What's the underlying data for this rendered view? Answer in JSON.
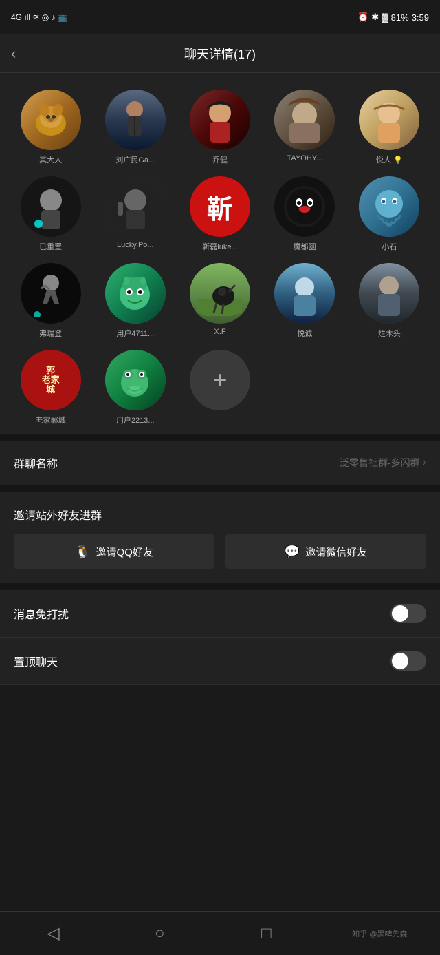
{
  "statusBar": {
    "signal": "4G",
    "time": "3:59",
    "battery": "81%"
  },
  "header": {
    "back": "‹",
    "title": "聊天详情(17)"
  },
  "members": [
    {
      "id": 1,
      "name": "真大人",
      "avatarClass": "av-shiba"
    },
    {
      "id": 2,
      "name": "刘广民Ga...",
      "avatarClass": "av-figure"
    },
    {
      "id": 3,
      "name": "乔健",
      "avatarClass": "av-girl"
    },
    {
      "id": 4,
      "name": "TAYOHY...",
      "avatarClass": "av-ancient"
    },
    {
      "id": 5,
      "name": "悦人 💡",
      "avatarClass": "av-lady"
    },
    {
      "id": 6,
      "name": "已重置",
      "avatarClass": "av-tiktok-man"
    },
    {
      "id": 7,
      "name": "Lucky.Po...",
      "avatarClass": "av-lucky"
    },
    {
      "id": 8,
      "name": "靳磊luke...",
      "avatarClass": "av-zhan",
      "text": "靳"
    },
    {
      "id": 9,
      "name": "魔都圆",
      "avatarClass": "av-kumamon"
    },
    {
      "id": 10,
      "name": "小石",
      "avatarClass": "av-octopus"
    },
    {
      "id": 11,
      "name": "弗瑞登",
      "avatarClass": "av-runner"
    },
    {
      "id": 12,
      "name": "用户4711...",
      "avatarClass": "av-monster-green"
    },
    {
      "id": 13,
      "name": "X.F",
      "avatarClass": "av-horse-field"
    },
    {
      "id": 14,
      "name": "悦诚",
      "avatarClass": "av-person-blue"
    },
    {
      "id": 15,
      "name": "烂木头",
      "avatarClass": "av-outdoor"
    },
    {
      "id": 16,
      "name": "老家郸城",
      "avatarClass": "av-郭",
      "text": "郭老家城"
    },
    {
      "id": 17,
      "name": "用户2213...",
      "avatarClass": "av-frog"
    }
  ],
  "addButton": {
    "icon": "+"
  },
  "groupName": {
    "label": "群聊名称",
    "value": "泛零售社群-多闪群"
  },
  "inviteSection": {
    "title": "邀请站外好友进群",
    "qqButton": "邀请QQ好友",
    "wechatButton": "邀请微信好友"
  },
  "settings": [
    {
      "id": "mute",
      "label": "消息免打扰",
      "toggleOn": false
    },
    {
      "id": "pin",
      "label": "置顶聊天",
      "toggleOn": false
    }
  ],
  "bottomNav": {
    "back": "◁",
    "home": "○",
    "recent": "□"
  },
  "watermark": "知乎 @黑啤先森"
}
